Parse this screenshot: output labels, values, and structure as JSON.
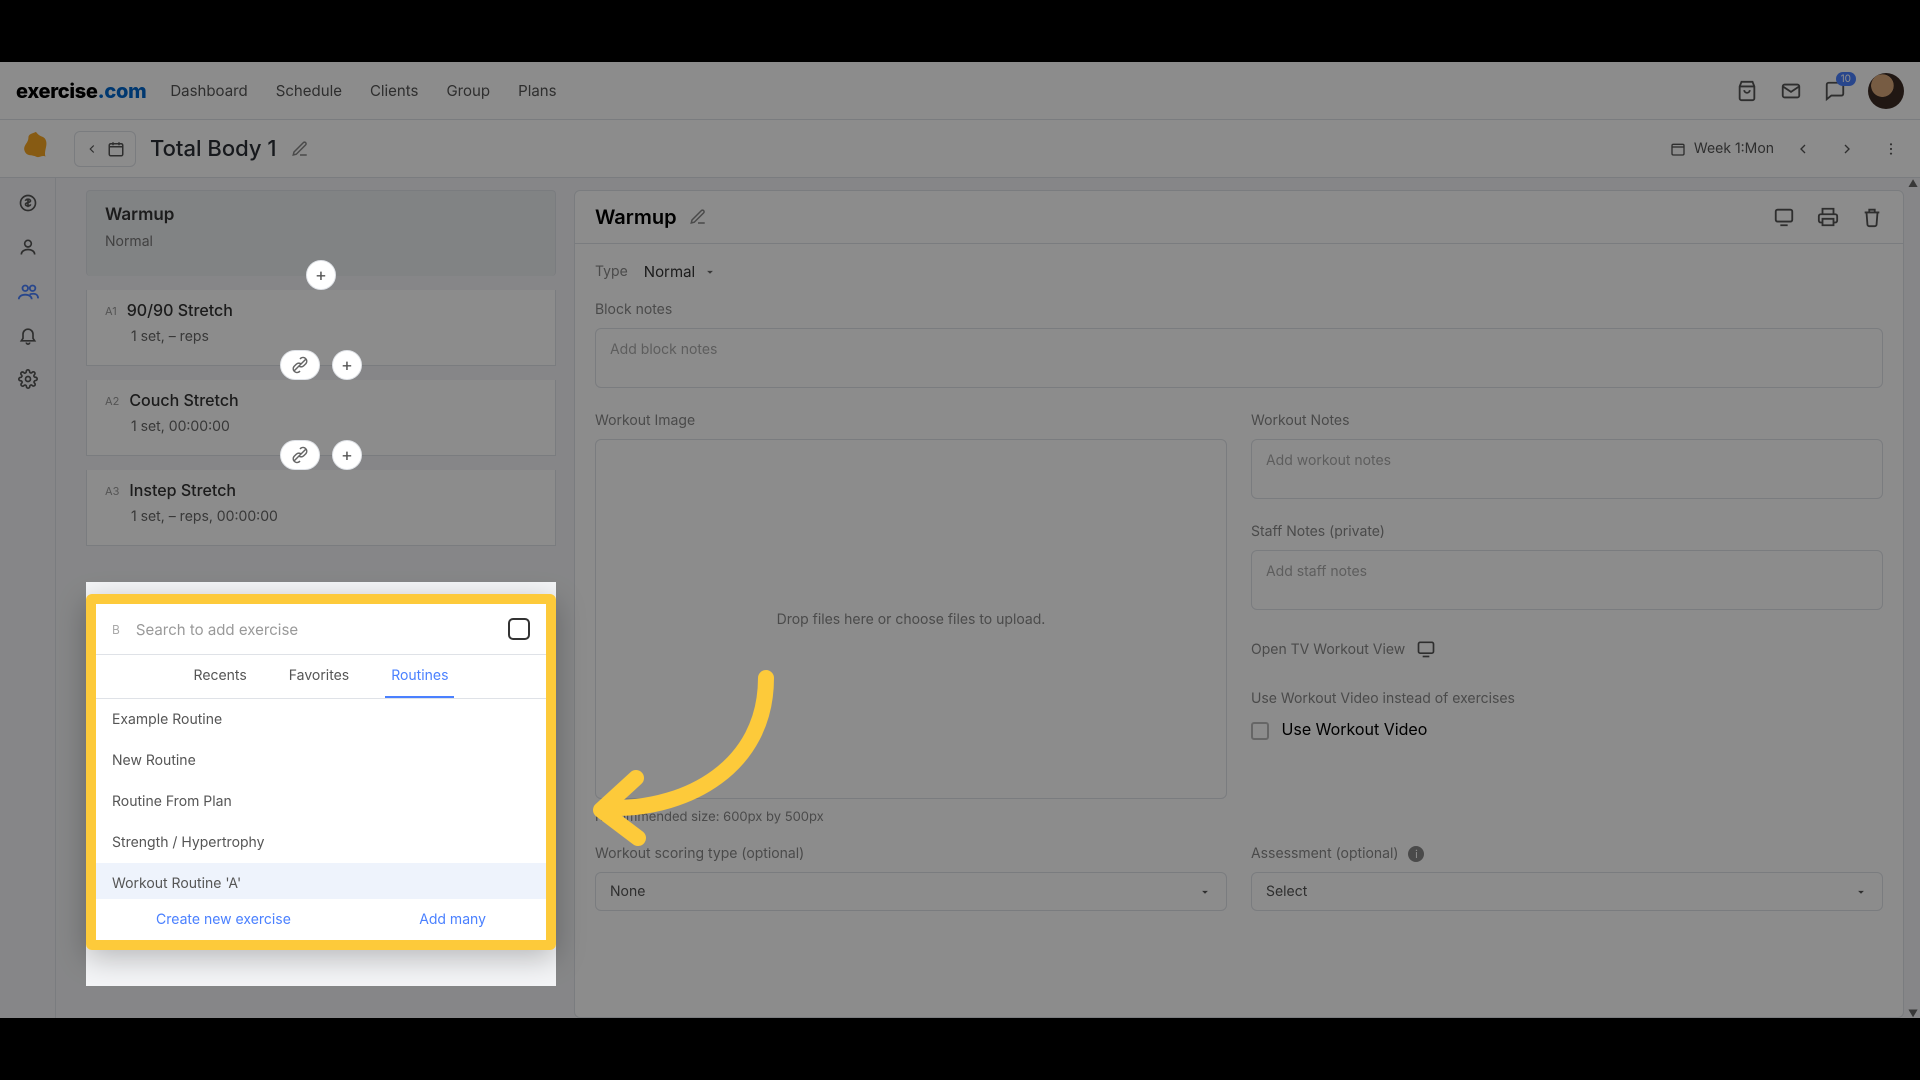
{
  "brand": {
    "name_a": "exercise",
    "name_b": ".com"
  },
  "nav": {
    "dashboard": "Dashboard",
    "schedule": "Schedule",
    "clients": "Clients",
    "group": "Group",
    "plans": "Plans"
  },
  "notifications": {
    "count": "10"
  },
  "header": {
    "title": "Total Body 1",
    "week_label": "Week 1:Mon"
  },
  "block": {
    "name": "Warmup",
    "type": "Normal"
  },
  "exercises": [
    {
      "tag": "A1",
      "name": "90/90 Stretch",
      "meta": "1 set, – reps"
    },
    {
      "tag": "A2",
      "name": "Couch Stretch",
      "meta": "1 set, 00:00:00"
    },
    {
      "tag": "A3",
      "name": "Instep Stretch",
      "meta": "1 set, – reps, 00:00:00"
    }
  ],
  "popup": {
    "search_label": "B",
    "search_placeholder": "Search to add exercise",
    "tabs": {
      "recents": "Recents",
      "favorites": "Favorites",
      "routines": "Routines"
    },
    "items": [
      "Example Routine",
      "New Routine",
      "Routine From Plan",
      "Strength / Hypertrophy",
      "Workout Routine 'A'"
    ],
    "create": "Create new exercise",
    "many": "Add many"
  },
  "panel": {
    "title": "Warmup",
    "type_label": "Type",
    "type_sel": "Normal",
    "block_notes_label": "Block notes",
    "block_notes_ph": "Add block notes",
    "workout_image_label": "Workout Image",
    "drop_text": "Drop files here or choose files to upload.",
    "rec_size": "Recommended size: 600px by 500px",
    "workout_notes_label": "Workout Notes",
    "workout_notes_ph": "Add workout notes",
    "staff_label": "Staff Notes (private)",
    "staff_ph": "Add staff notes",
    "tv_label": "Open TV Workout View",
    "usevideo_label": "Use Workout Video instead of exercises",
    "usevideo_chk": "Use Workout Video",
    "scoring_label": "Workout scoring type (optional)",
    "scoring_sel": "None",
    "assessment_label": "Assessment (optional)",
    "assessment_sel": "Select"
  }
}
